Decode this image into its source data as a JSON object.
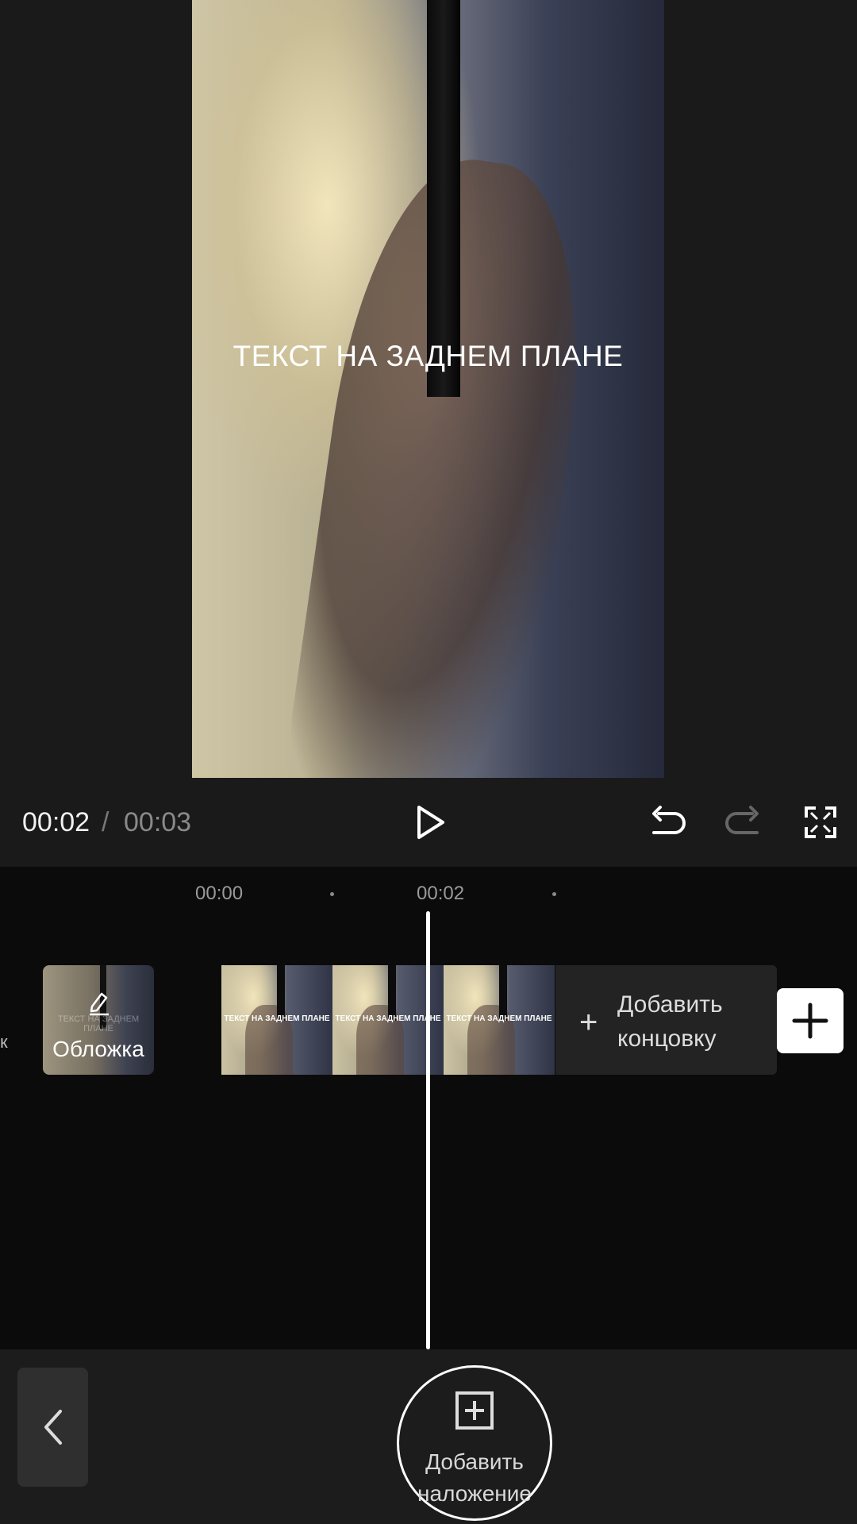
{
  "preview": {
    "overlay_text": "ТЕКСТ НА ЗАДНЕМ ПЛАНЕ"
  },
  "controls": {
    "time_current": "00:02",
    "time_separator": "/",
    "time_total": "00:03",
    "play_icon": "play-icon",
    "undo_icon": "undo-icon",
    "redo_icon": "redo-icon",
    "fullscreen_icon": "fullscreen-icon"
  },
  "timeline": {
    "ticks": [
      "00:00",
      "00:02"
    ],
    "left_edge_text": "к",
    "cover": {
      "label": "Обложка",
      "thumb_text": "ТЕКСТ НА ЗАДНЕМ ПЛАНЕ",
      "icon": "edit-icon"
    },
    "clips": [
      {
        "text": "ТЕКСТ НА ЗАДНЕМ ПЛАНЕ"
      },
      {
        "text": "ТЕКСТ НА ЗАДНЕМ ПЛАНЕ"
      },
      {
        "text": "ТЕКСТ НА ЗАДНЕМ ПЛАНЕ"
      }
    ],
    "add_ending": {
      "plus": "+",
      "label": "Добавить\nконцовку"
    },
    "add_clip_icon": "plus-icon"
  },
  "bottom_bar": {
    "back_icon": "chevron-left-icon",
    "add_overlay": {
      "label": "Добавить\nналожение",
      "icon": "plus-square-icon"
    }
  }
}
